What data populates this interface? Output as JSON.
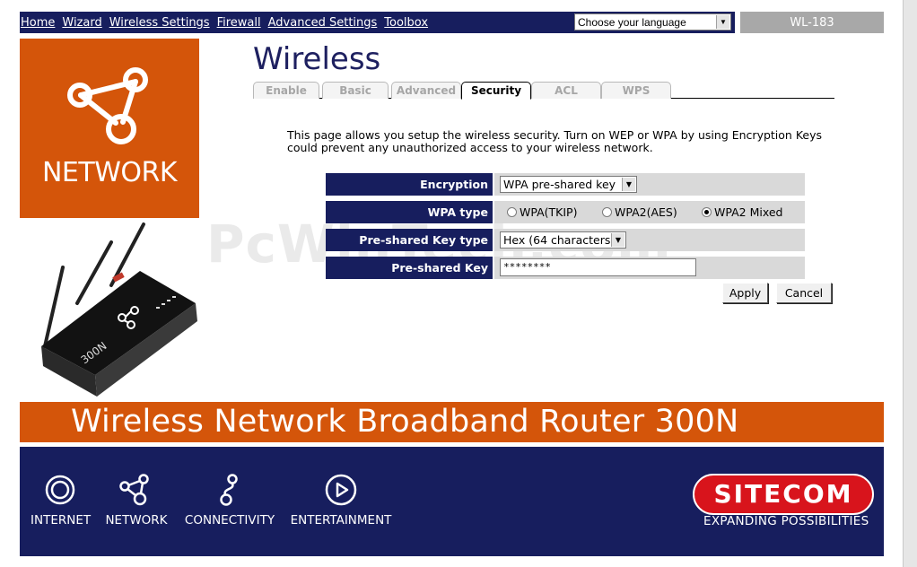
{
  "nav": {
    "links": [
      "Home",
      "Wizard",
      "Wireless Settings",
      "Firewall",
      "Advanced Settings",
      "Toolbox"
    ],
    "language_select": "Choose your language"
  },
  "model": "WL-183",
  "logo": {
    "word": "NETWORK"
  },
  "page": {
    "title": "Wireless",
    "tabs": [
      "Enable",
      "Basic",
      "Advanced",
      "Security",
      "ACL",
      "WPS"
    ],
    "active_tab": "Security",
    "description": "This page allows you setup the wireless security. Turn on WEP or WPA by using Encryption Keys could prevent any unauthorized access to your wireless network."
  },
  "form": {
    "encryption": {
      "label": "Encryption",
      "value": "WPA pre-shared key"
    },
    "wpa_type": {
      "label": "WPA type",
      "options": [
        "WPA(TKIP)",
        "WPA2(AES)",
        "WPA2 Mixed"
      ],
      "selected": "WPA2 Mixed"
    },
    "psk_type": {
      "label": "Pre-shared Key type",
      "value": "Hex (64 characters)"
    },
    "psk": {
      "label": "Pre-shared Key",
      "value": "********"
    },
    "apply_label": "Apply",
    "cancel_label": "Cancel"
  },
  "watermark": "PcWinTech.com",
  "banner": "Wireless Network Broadband Router 300N",
  "footer": {
    "items": [
      "INTERNET",
      "NETWORK",
      "CONNECTIVITY",
      "ENTERTAINMENT"
    ],
    "brand": "SITECOM",
    "tagline": "EXPANDING POSSIBILITIES"
  },
  "colors": {
    "navy": "#171e5e",
    "orange": "#d4550a",
    "brand_red": "#d8141c"
  }
}
